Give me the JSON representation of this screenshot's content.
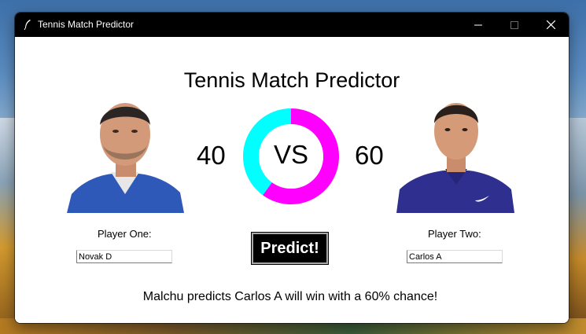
{
  "window": {
    "title": "Tennis Match Predictor",
    "controls": [
      "minimize",
      "maximize",
      "close"
    ]
  },
  "app": {
    "heading": "Tennis Match Predictor",
    "player_one": {
      "label": "Player One:",
      "name_value": "Novak D",
      "score": "40",
      "photo": "player-one-photo"
    },
    "player_two": {
      "label": "Player Two:",
      "name_value": "Carlos A",
      "score": "60",
      "photo": "player-two-photo"
    },
    "versus_text": "VS",
    "chart": {
      "segments": [
        {
          "player": "Novak D",
          "value": 40,
          "color": "#00ffff"
        },
        {
          "player": "Carlos A",
          "value": 60,
          "color": "#ff00ff"
        }
      ]
    },
    "predict_label": "Predict!",
    "result_text": "Malchu predicts Carlos A will win with a 60% chance!"
  }
}
